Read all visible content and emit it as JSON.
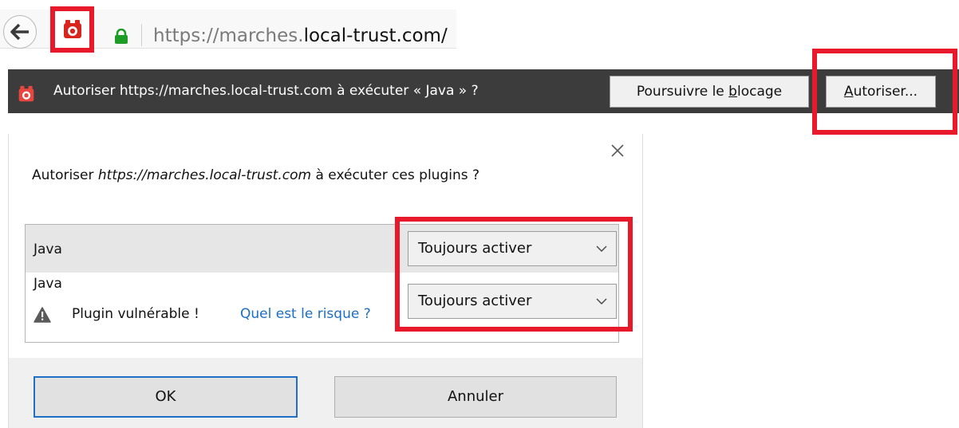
{
  "urlbar": {
    "url_prefix": "https://marches.",
    "url_host": "local-trust.com/",
    "icons": [
      "back-arrow-icon",
      "plugin-blocked-icon",
      "lock-icon"
    ]
  },
  "notification": {
    "message": "Autoriser https://marches.local-trust.com à exécuter « Java » ?",
    "block_button": {
      "pre": "Poursuivre le ",
      "key": "b",
      "post": "locage"
    },
    "allow_button": {
      "key": "A",
      "post": "utoriser..."
    }
  },
  "dialog": {
    "question_pre": "Autoriser ",
    "question_site": "https://marches.local-trust.com",
    "question_post": " à exécuter ces plugins ?",
    "plugins": [
      {
        "name": "Java",
        "setting": "Toujours activer"
      },
      {
        "name": "Java",
        "setting": "Toujours activer",
        "warning": "Plugin vulnérable !",
        "risk_link": "Quel est le risque ?"
      }
    ],
    "ok_label": "OK",
    "cancel_label": "Annuler"
  },
  "colors": {
    "highlight": "#e8192b",
    "notification_bg": "#3c3c3c",
    "link": "#1a6fc4",
    "ok_border": "#1f6fc5"
  }
}
